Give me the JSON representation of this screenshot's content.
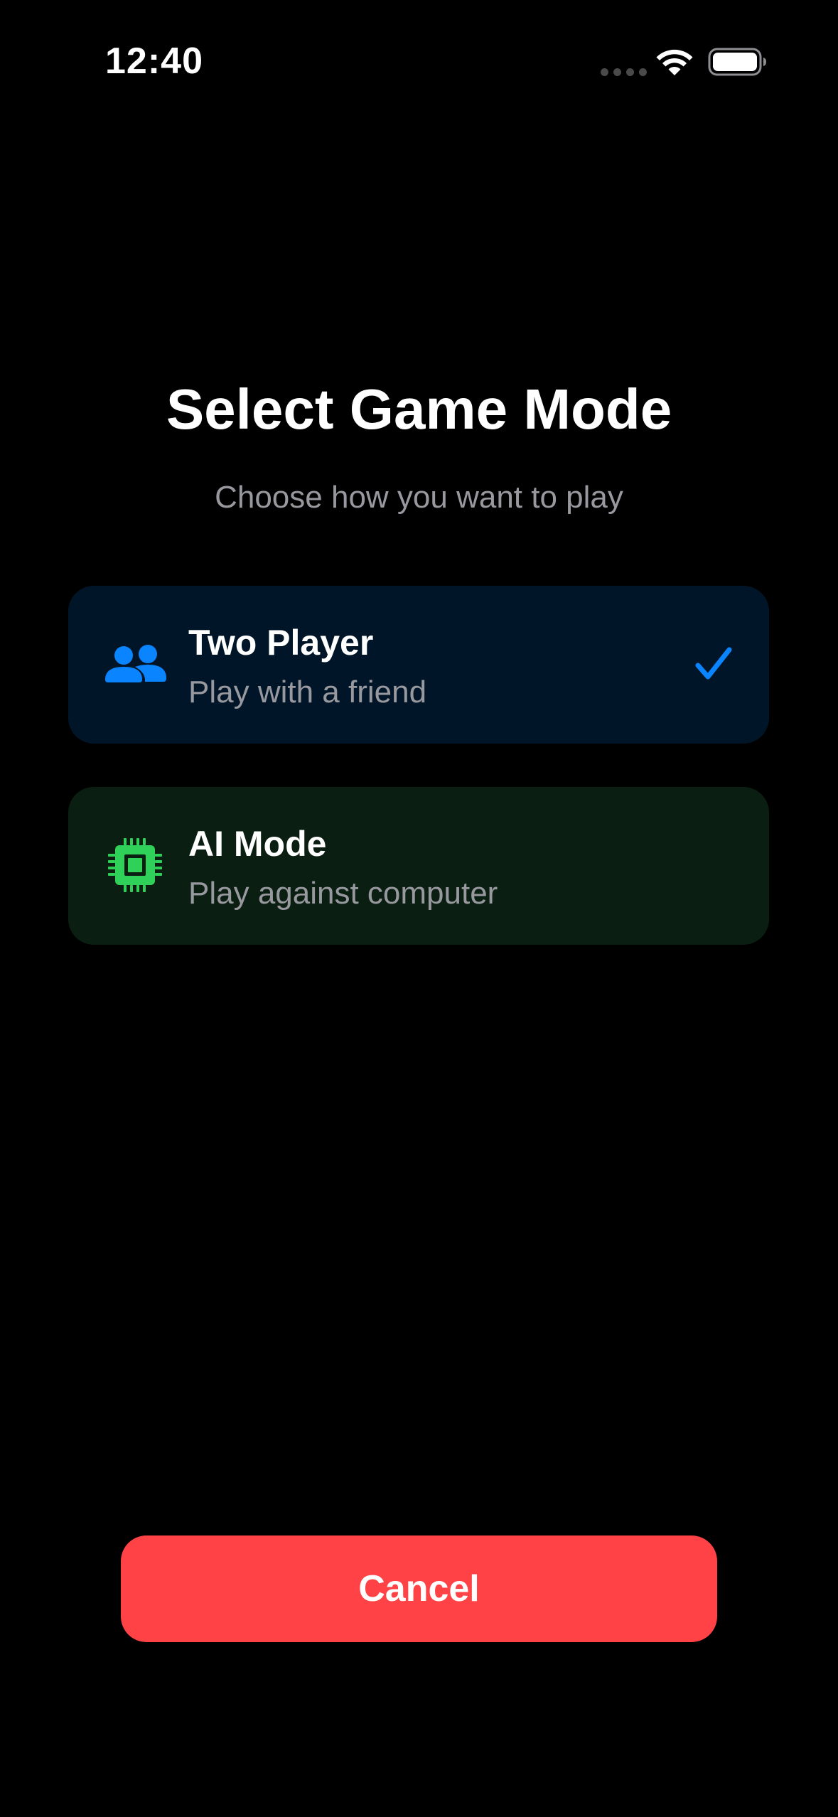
{
  "status_bar": {
    "time": "12:40",
    "signal_icon": "cellular-signal-icon",
    "wifi_icon": "wifi-icon",
    "battery_icon": "battery-icon"
  },
  "header": {
    "title": "Select Game Mode",
    "subtitle": "Choose how you want to play"
  },
  "options": [
    {
      "title": "Two Player",
      "description": "Play with a friend",
      "icon": "two-people-icon",
      "selected": true,
      "background": "#001628",
      "accent": "#0a84ff"
    },
    {
      "title": "AI Mode",
      "description": "Play against computer",
      "icon": "cpu-chip-icon",
      "selected": false,
      "background": "#0a1f11",
      "accent": "#30d158"
    }
  ],
  "footer": {
    "cancel_label": "Cancel",
    "cancel_color": "#ff4245"
  }
}
